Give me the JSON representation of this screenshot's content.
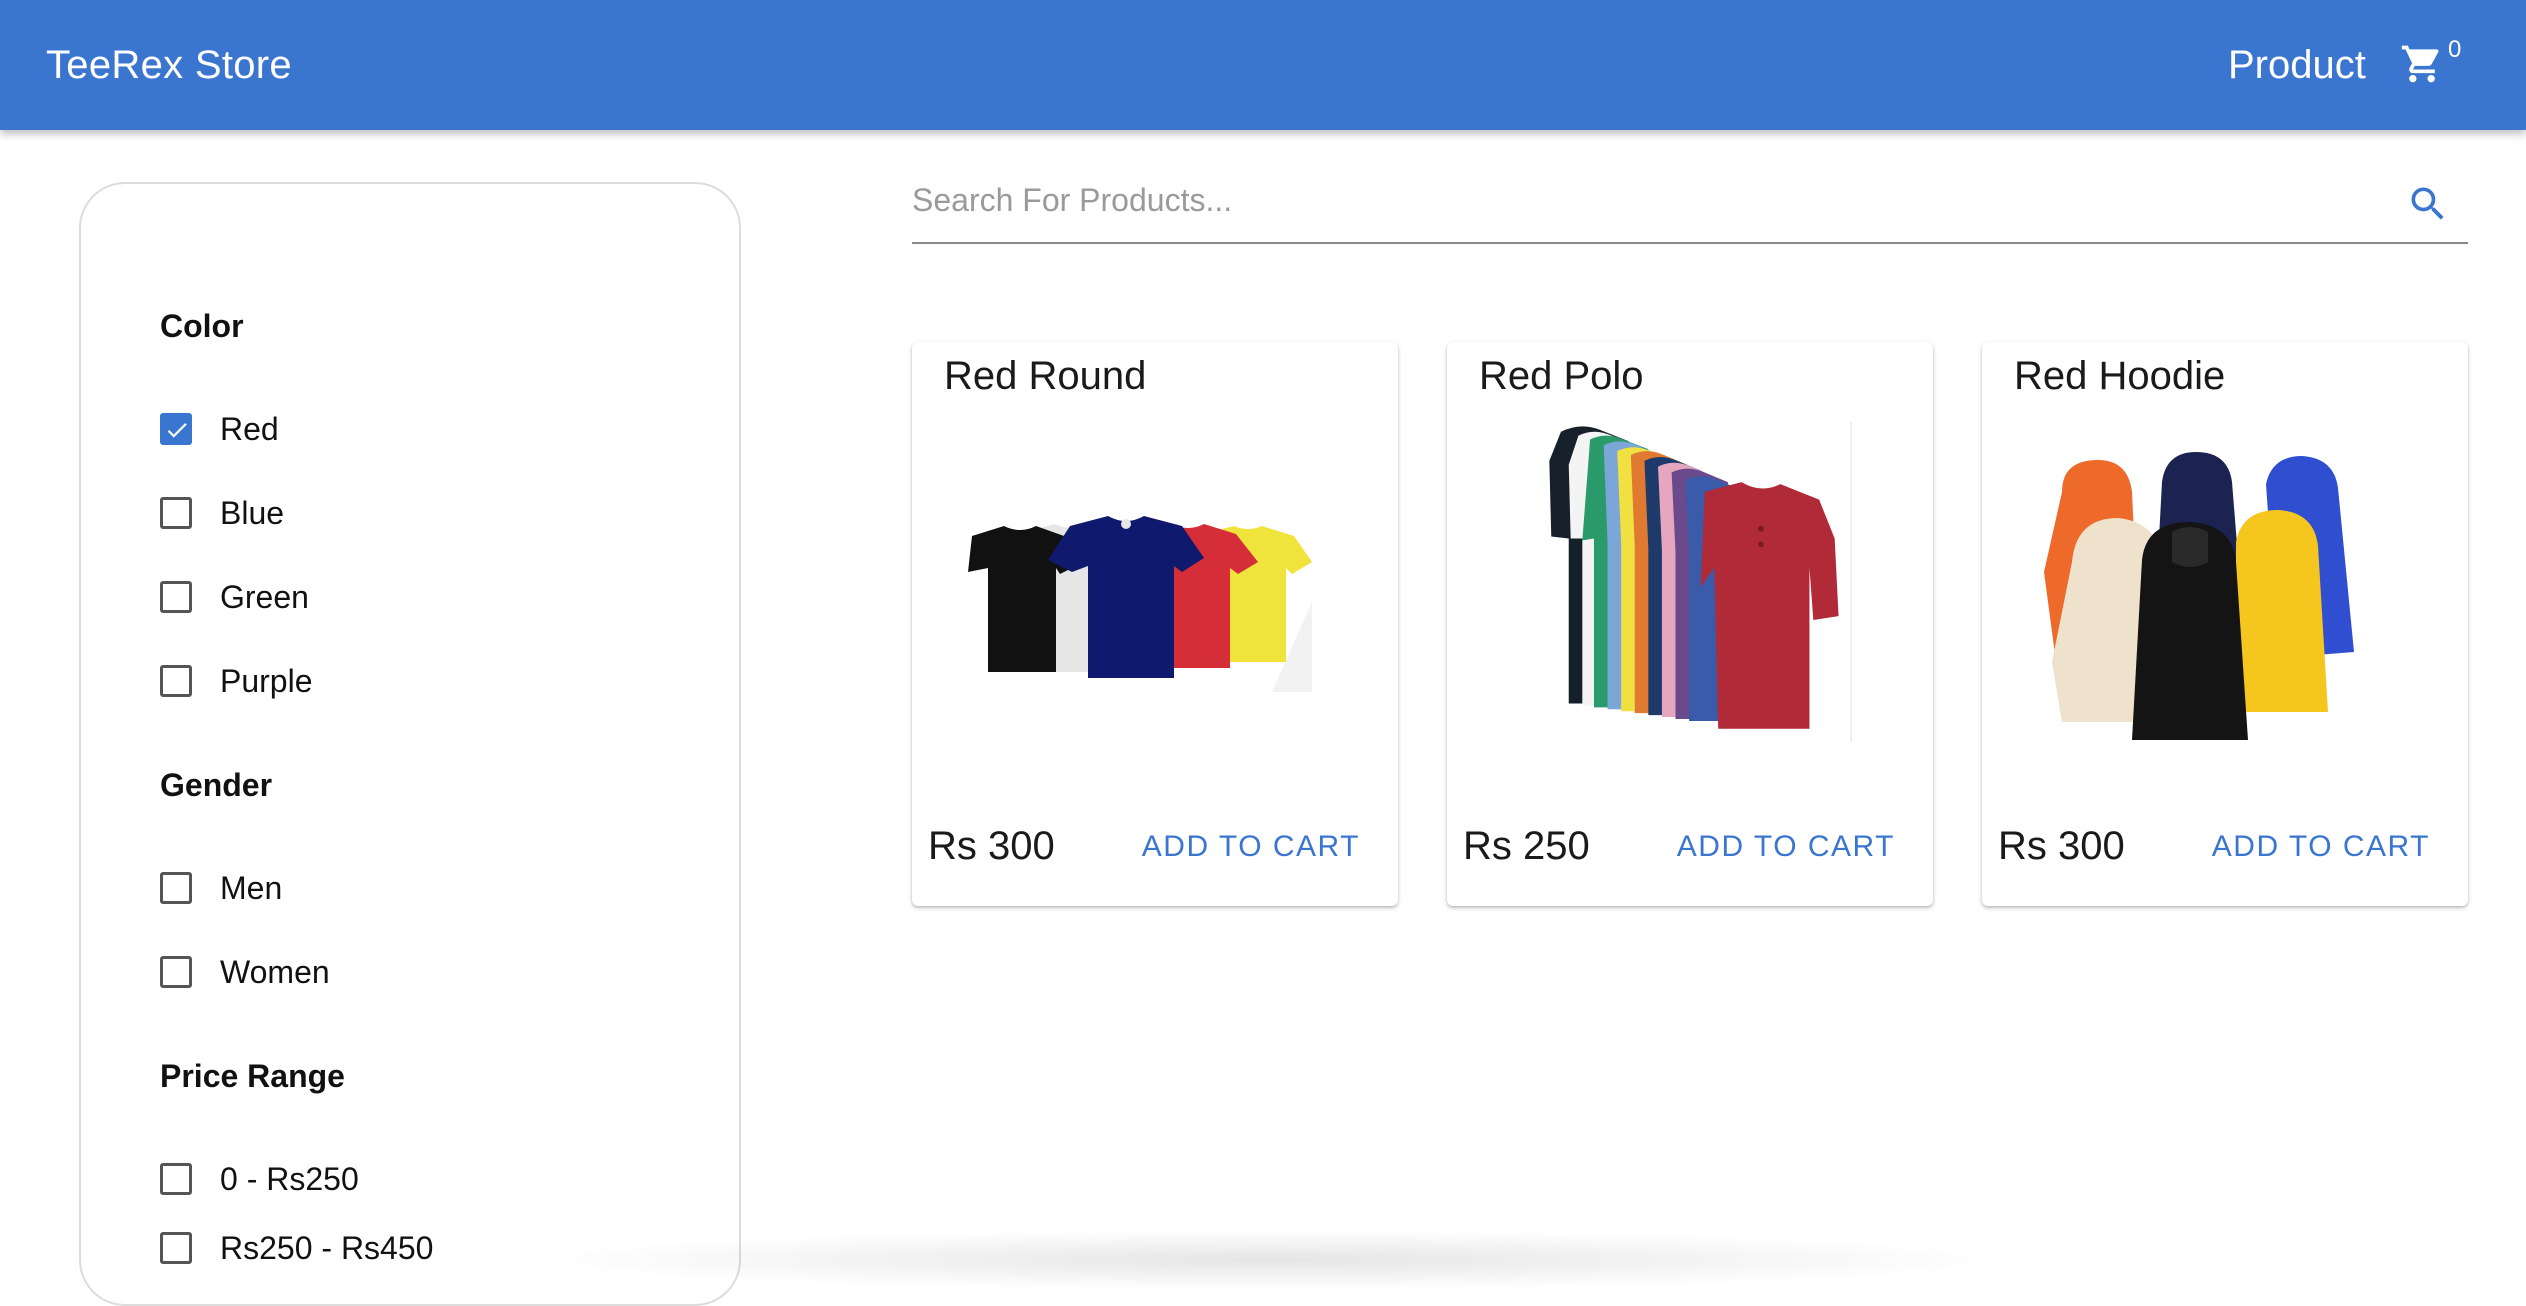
{
  "header": {
    "brand": "TeeRex Store",
    "nav_product": "Product",
    "cart_count": "0",
    "background_color": "#3a76cf"
  },
  "search": {
    "placeholder": "Search For Products...",
    "value": ""
  },
  "filters": {
    "color": {
      "heading": "Color",
      "options": [
        {
          "label": "Red",
          "checked": true
        },
        {
          "label": "Blue",
          "checked": false
        },
        {
          "label": "Green",
          "checked": false
        },
        {
          "label": "Purple",
          "checked": false
        }
      ]
    },
    "gender": {
      "heading": "Gender",
      "options": [
        {
          "label": "Men",
          "checked": false
        },
        {
          "label": "Women",
          "checked": false
        }
      ]
    },
    "price": {
      "heading": "Price Range",
      "options": [
        {
          "label": "0 - Rs250",
          "checked": false
        },
        {
          "label": "Rs250 - Rs450",
          "checked": false
        }
      ]
    }
  },
  "products": [
    {
      "name": "Red Round",
      "price": "Rs 300",
      "add_label": "ADD TO CART",
      "image": "round-tshirts-image"
    },
    {
      "name": "Red Polo",
      "price": "Rs 250",
      "add_label": "ADD TO CART",
      "image": "polo-shirts-image"
    },
    {
      "name": "Red Hoodie",
      "price": "Rs 300",
      "add_label": "ADD TO CART",
      "image": "hoodies-image"
    }
  ],
  "colors": {
    "accent": "#3a76cf"
  }
}
